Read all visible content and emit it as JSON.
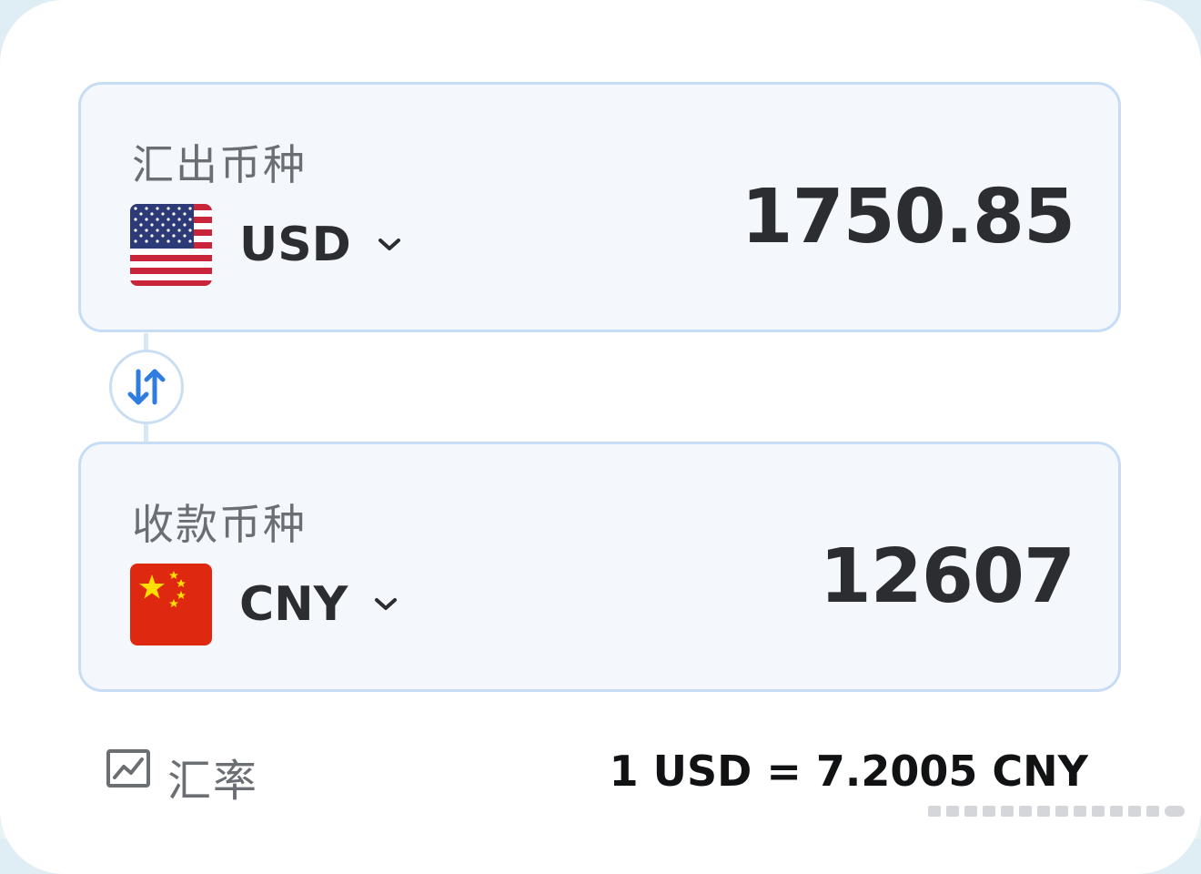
{
  "send": {
    "label": "汇出币种",
    "currency_code": "USD",
    "flag_icon": "us-flag",
    "amount": "1750.85"
  },
  "receive": {
    "label": "收款币种",
    "currency_code": "CNY",
    "flag_icon": "cn-flag",
    "amount": "12607"
  },
  "swap": {
    "icon": "swap-arrows-icon"
  },
  "rate": {
    "icon": "trend-chart-icon",
    "label": "汇率",
    "value": "1 USD = 7.2005 CNY"
  },
  "colors": {
    "accent": "#2f7de1",
    "box_background": "#f4f7fc",
    "box_border": "#c6ddf5",
    "text_primary": "#2b2d31",
    "text_secondary": "#6b6e72"
  }
}
